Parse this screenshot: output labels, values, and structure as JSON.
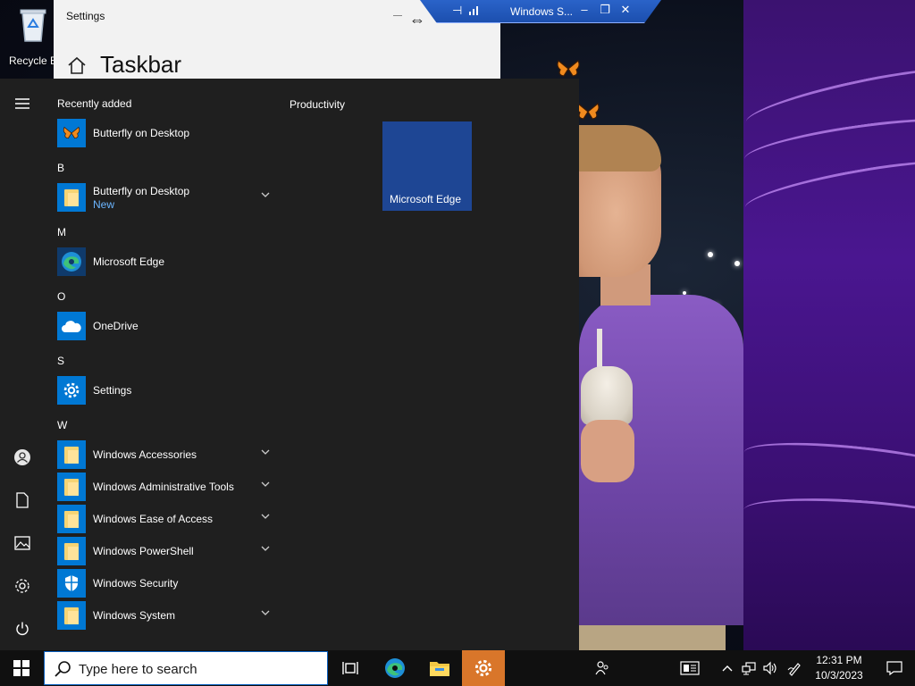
{
  "desktop": {
    "recycle_bin_label": "Recycle B"
  },
  "settings_window": {
    "title": "Settings",
    "heading": "Taskbar"
  },
  "remote_bar": {
    "title": "Windows S..."
  },
  "start_menu": {
    "recently_added_header": "Recently added",
    "group_title": "Productivity",
    "tile_label": "Microsoft Edge",
    "sections": [
      {
        "letter": "",
        "apps": [
          {
            "name": "Butterfly on Desktop",
            "icon": "butterfly-icon"
          }
        ]
      },
      {
        "letter": "B",
        "apps": [
          {
            "name": "Butterfly on Desktop",
            "sub": "New",
            "icon": "folder-icon",
            "expandable": true
          }
        ]
      },
      {
        "letter": "M",
        "apps": [
          {
            "name": "Microsoft Edge",
            "icon": "edge-icon"
          }
        ]
      },
      {
        "letter": "O",
        "apps": [
          {
            "name": "OneDrive",
            "icon": "cloud-icon"
          }
        ]
      },
      {
        "letter": "S",
        "apps": [
          {
            "name": "Settings",
            "icon": "gear-icon"
          }
        ]
      },
      {
        "letter": "W",
        "apps": [
          {
            "name": "Windows Accessories",
            "icon": "folder-icon",
            "expandable": true
          },
          {
            "name": "Windows Administrative Tools",
            "icon": "folder-icon",
            "expandable": true
          },
          {
            "name": "Windows Ease of Access",
            "icon": "folder-icon",
            "expandable": true
          },
          {
            "name": "Windows PowerShell",
            "icon": "folder-icon",
            "expandable": true
          },
          {
            "name": "Windows Security",
            "icon": "shield-icon"
          },
          {
            "name": "Windows System",
            "icon": "folder-icon",
            "expandable": true
          }
        ]
      }
    ]
  },
  "taskbar": {
    "search_placeholder": "Type here to search",
    "time": "12:31 PM",
    "date": "10/3/2023",
    "active_app": "settings"
  },
  "colors": {
    "accent": "#0078d4",
    "tile": "#1e4694",
    "active_taskbar": "#d9762a",
    "start_bg": "#1f1f1f"
  }
}
